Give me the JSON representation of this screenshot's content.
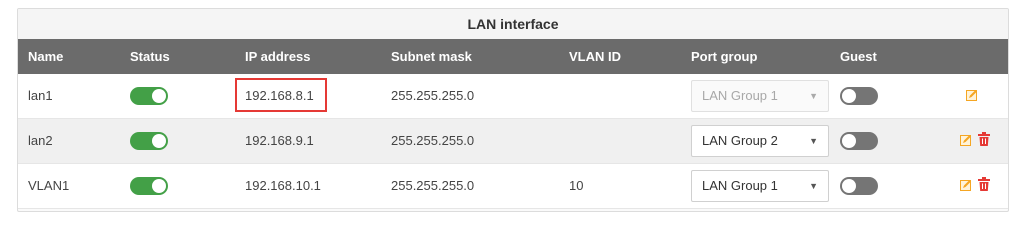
{
  "panel": {
    "title": "LAN interface"
  },
  "columns": {
    "name": "Name",
    "status": "Status",
    "ip": "IP address",
    "mask": "Subnet mask",
    "vlan": "VLAN ID",
    "port": "Port group",
    "guest": "Guest"
  },
  "rows": [
    {
      "name": "lan1",
      "status": "on",
      "ip": "192.168.8.1",
      "mask": "255.255.255.0",
      "vlan_id": "",
      "port_group": "LAN Group 1",
      "port_group_disabled": true,
      "guest": "off",
      "actions": [
        "edit-icon"
      ]
    },
    {
      "name": "lan2",
      "status": "on",
      "ip": "192.168.9.1",
      "mask": "255.255.255.0",
      "vlan_id": "",
      "port_group": "LAN Group 2",
      "port_group_disabled": false,
      "guest": "off",
      "actions": [
        "edit-icon",
        "trash-icon"
      ]
    },
    {
      "name": "VLAN1",
      "status": "on",
      "ip": "192.168.10.1",
      "mask": "255.255.255.0",
      "vlan_id": "10",
      "port_group": "LAN Group 1",
      "port_group_disabled": false,
      "guest": "off",
      "actions": [
        "edit-icon",
        "trash-icon"
      ]
    }
  ],
  "colors": {
    "toggle_on": "#43a047",
    "toggle_off": "#757575",
    "header_bg": "#6b6b6b",
    "highlight": "#e53935",
    "edit": "#f5a623",
    "delete": "#e53935"
  }
}
